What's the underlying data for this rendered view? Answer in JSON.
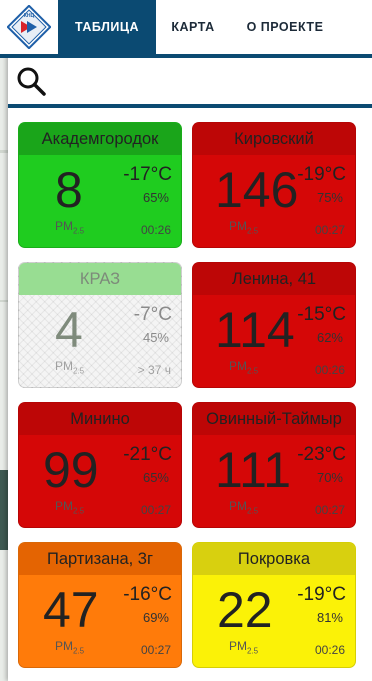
{
  "nav": {
    "tabs": [
      {
        "label": "ТАБЛИЦА"
      },
      {
        "label": "КАРТА"
      },
      {
        "label": "О ПРОЕКТЕ"
      }
    ],
    "logo_text": "КНЦ"
  },
  "search": {
    "placeholder": "",
    "value": ""
  },
  "pm_label": "PM",
  "pm_sub": "2.5",
  "stations": [
    {
      "name": "Академгородок",
      "pm25": "8",
      "temperature": "-17°C",
      "humidity": "65%",
      "time": "00:26",
      "status": "green"
    },
    {
      "name": "Кировский",
      "pm25": "146",
      "temperature": "-19°C",
      "humidity": "75%",
      "time": "00:27",
      "status": "red"
    },
    {
      "name": "КРАЗ",
      "pm25": "4",
      "temperature": "-7°C",
      "humidity": "45%",
      "time": "> 37 ч",
      "status": "stale"
    },
    {
      "name": "Ленина, 41",
      "pm25": "114",
      "temperature": "-15°C",
      "humidity": "62%",
      "time": "00:26",
      "status": "red"
    },
    {
      "name": "Минино",
      "pm25": "99",
      "temperature": "-21°C",
      "humidity": "65%",
      "time": "00:27",
      "status": "red"
    },
    {
      "name": "Овинный-Таймыр",
      "pm25": "111",
      "temperature": "-23°C",
      "humidity": "70%",
      "time": "00:27",
      "status": "red"
    },
    {
      "name": "Партизана, 3г",
      "pm25": "47",
      "temperature": "-16°C",
      "humidity": "69%",
      "time": "00:27",
      "status": "orange"
    },
    {
      "name": "Покровка",
      "pm25": "22",
      "temperature": "-19°C",
      "humidity": "81%",
      "time": "00:26",
      "status": "yellow"
    }
  ],
  "colors": {
    "nav_active": "#0b4a72",
    "green": "#1fcc1f",
    "red": "#d50707",
    "orange": "#ff7b0a",
    "yellow": "#fbf207",
    "stale_header": "#98dd92"
  }
}
